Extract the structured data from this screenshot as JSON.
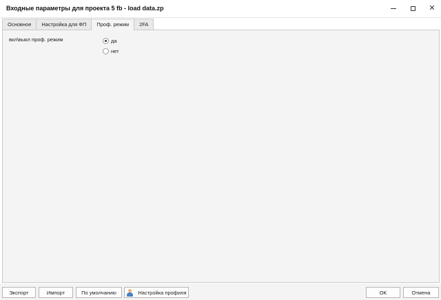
{
  "window": {
    "title": "Входные параметры для проекта 5 fb - load data.zp",
    "controls": [
      "minimize-icon",
      "maximize-icon",
      "close-icon"
    ]
  },
  "tabs": [
    {
      "label": "Основное",
      "active": false
    },
    {
      "label": "Настройка для ФП",
      "active": false
    },
    {
      "label": "Проф. режим",
      "active": true
    },
    {
      "label": "2FA",
      "active": false
    }
  ],
  "panel": {
    "param_label": "вкл\\выкл проф. режим",
    "options": [
      {
        "label": "да",
        "selected": true
      },
      {
        "label": "нет",
        "selected": false
      }
    ]
  },
  "buttons": {
    "export": "Экспорт",
    "import": "Импорт",
    "default": "По умолчанию",
    "profile": "Настройка профиля",
    "profile_icon": "user-icon",
    "ok": "OK",
    "cancel": "Отмена"
  }
}
